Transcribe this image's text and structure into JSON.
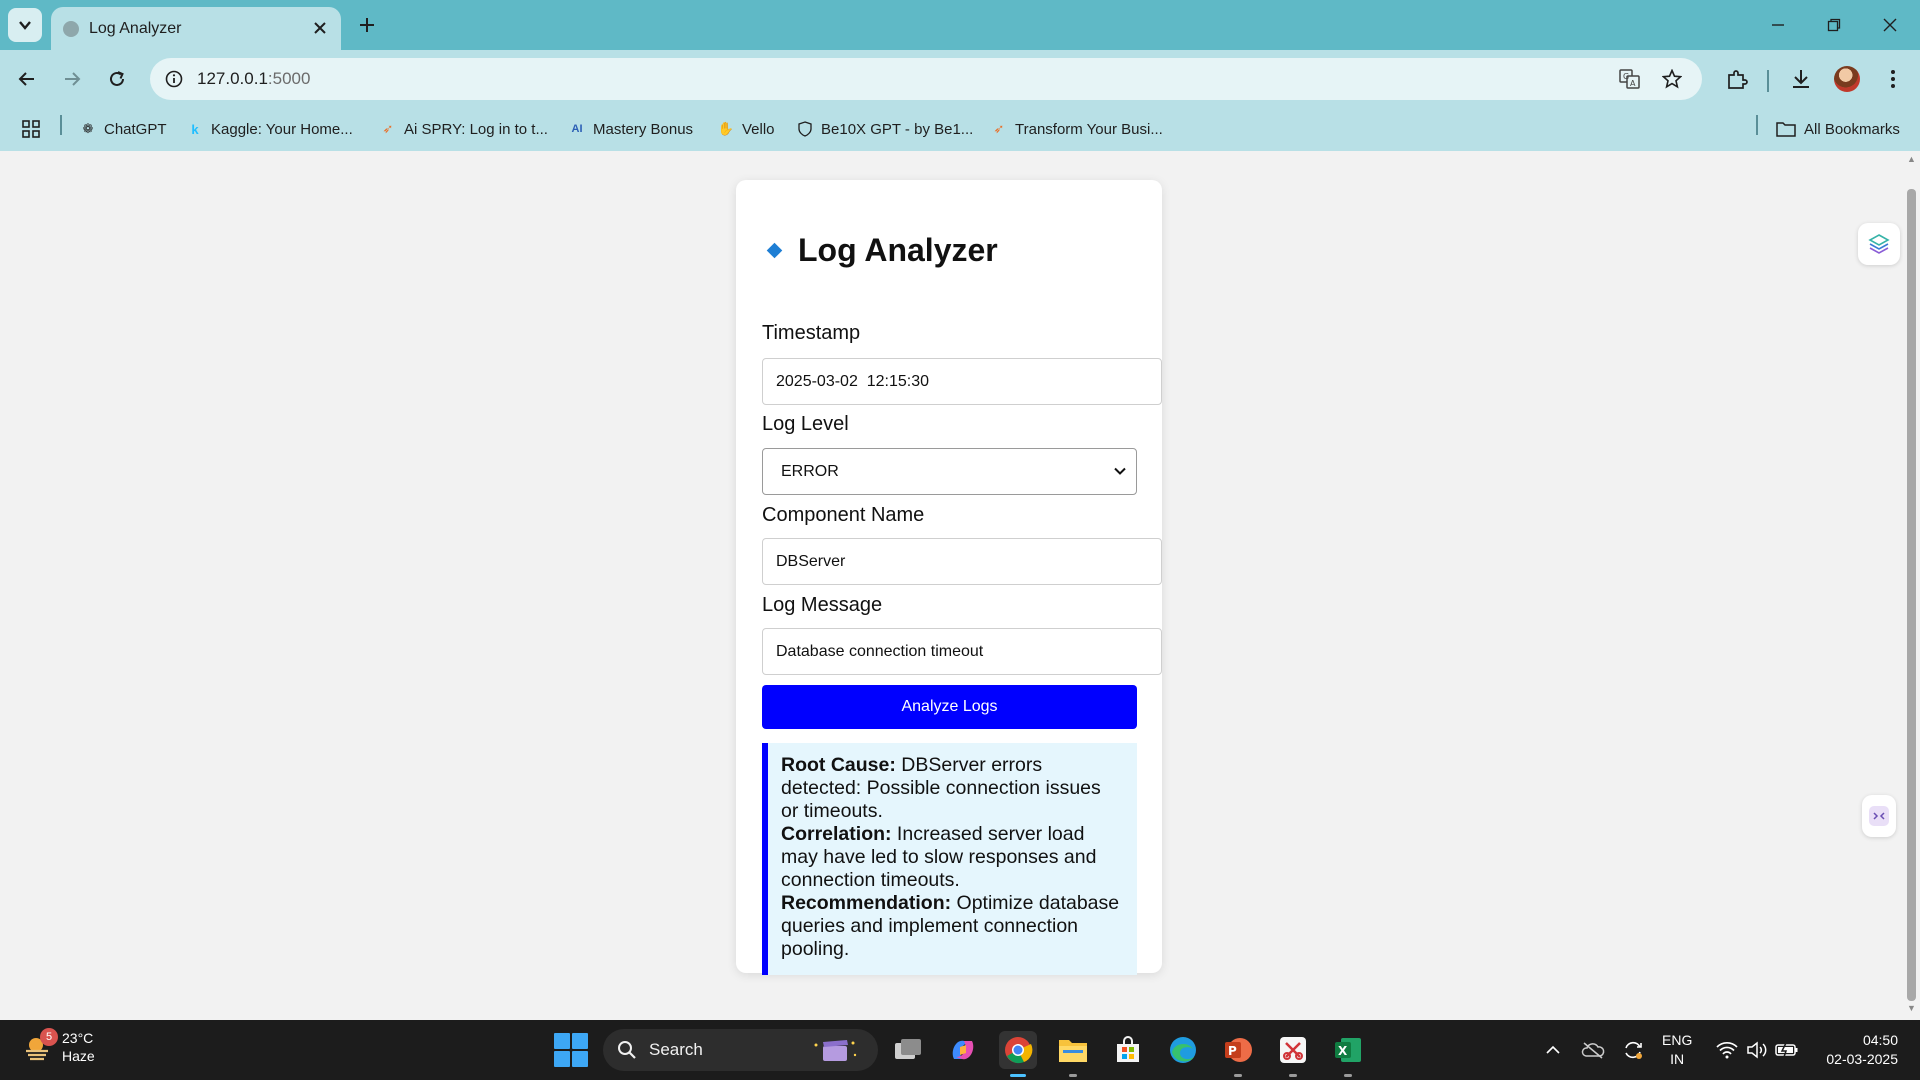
{
  "browser": {
    "tab": {
      "title": "Log Analyzer"
    },
    "address": {
      "host": "127.0.0.1",
      "port": ":5000"
    },
    "bookmarks": [
      {
        "label": "ChatGPT"
      },
      {
        "label": "Kaggle: Your Home..."
      },
      {
        "label": "Ai SPRY: Log in to t..."
      },
      {
        "label": "Mastery Bonus"
      },
      {
        "label": "Vello"
      },
      {
        "label": "Be10X GPT - by Be1..."
      },
      {
        "label": "Transform Your Busi..."
      }
    ],
    "all_bookmarks_label": "All Bookmarks"
  },
  "app": {
    "title": "Log Analyzer",
    "fields": {
      "timestamp": {
        "label": "Timestamp",
        "value": "2025-03-02  12:15:30"
      },
      "log_level": {
        "label": "Log Level",
        "value": "ERROR"
      },
      "component": {
        "label": "Component Name",
        "value": "DBServer"
      },
      "message": {
        "label": "Log Message",
        "value": "Database connection timeout"
      }
    },
    "analyze_button": "Analyze Logs",
    "result": {
      "root_cause_label": "Root Cause:",
      "root_cause": " DBServer errors detected: Possible connection issues or timeouts.",
      "correlation_label": "Correlation:",
      "correlation": " Increased server load may have led to slow responses and connection timeouts.",
      "recommendation_label": "Recommendation:",
      "recommendation": " Optimize database queries and implement connection pooling."
    }
  },
  "taskbar": {
    "weather": {
      "temp": "23°C",
      "condition": "Haze",
      "badge": "5"
    },
    "search_label": "Search",
    "language": {
      "line1": "ENG",
      "line2": "IN"
    },
    "clock": {
      "time": "04:50",
      "date": "02-03-2025"
    }
  },
  "colors": {
    "chrome_teal": "#5fb9c6",
    "chrome_light": "#b8e0e6",
    "button_blue": "#0000ff",
    "result_bg": "#e5f6fd",
    "diamond": "#1e7ed4"
  }
}
